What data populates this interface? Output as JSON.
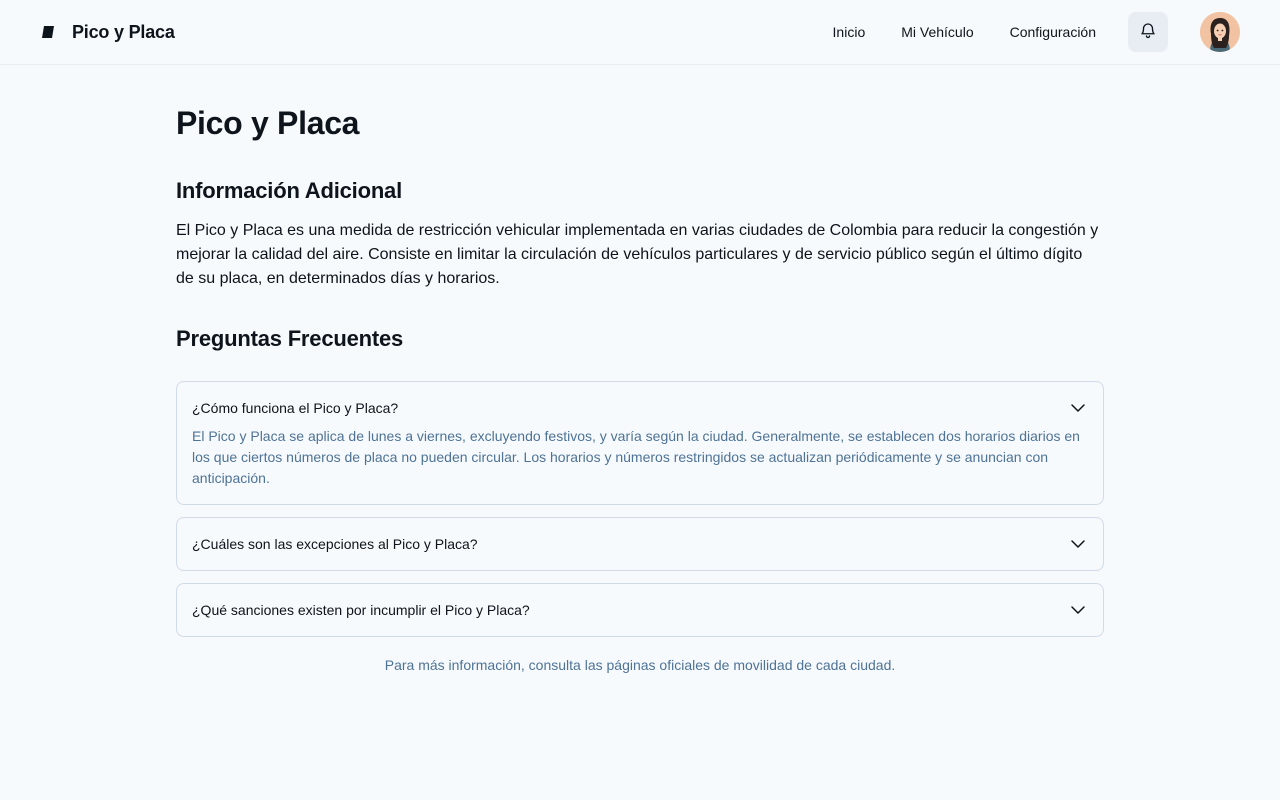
{
  "header": {
    "brand": "Pico y Placa",
    "nav": [
      "Inicio",
      "Mi Vehículo",
      "Configuración"
    ]
  },
  "main": {
    "title": "Pico y Placa",
    "info_title": "Información Adicional",
    "info_text": "El Pico y Placa es una medida de restricción vehicular implementada en varias ciudades de Colombia para reducir la congestión y mejorar la calidad del aire. Consiste en limitar la circulación de vehículos particulares y de servicio público según el último dígito de su placa, en determinados días y horarios.",
    "faq_title": "Preguntas Frecuentes",
    "faqs": [
      {
        "question": "¿Cómo funciona el Pico y Placa?",
        "answer": "El Pico y Placa se aplica de lunes a viernes, excluyendo festivos, y varía según la ciudad. Generalmente, se establecen dos horarios diarios en los que ciertos números de placa no pueden circular. Los horarios y números restringidos se actualizan periódicamente y se anuncian con anticipación."
      },
      {
        "question": "¿Cuáles son las excepciones al Pico y Placa?"
      },
      {
        "question": "¿Qué sanciones existen por incumplir el Pico y Placa?"
      }
    ],
    "footer_note": "Para más información, consulta las páginas oficiales de movilidad de cada ciudad."
  },
  "colors": {
    "background": "#f7fafc",
    "text": "#0e141b",
    "muted_text": "#4e7397",
    "border": "#d0dbe7",
    "button_bg": "#e7edf3"
  }
}
